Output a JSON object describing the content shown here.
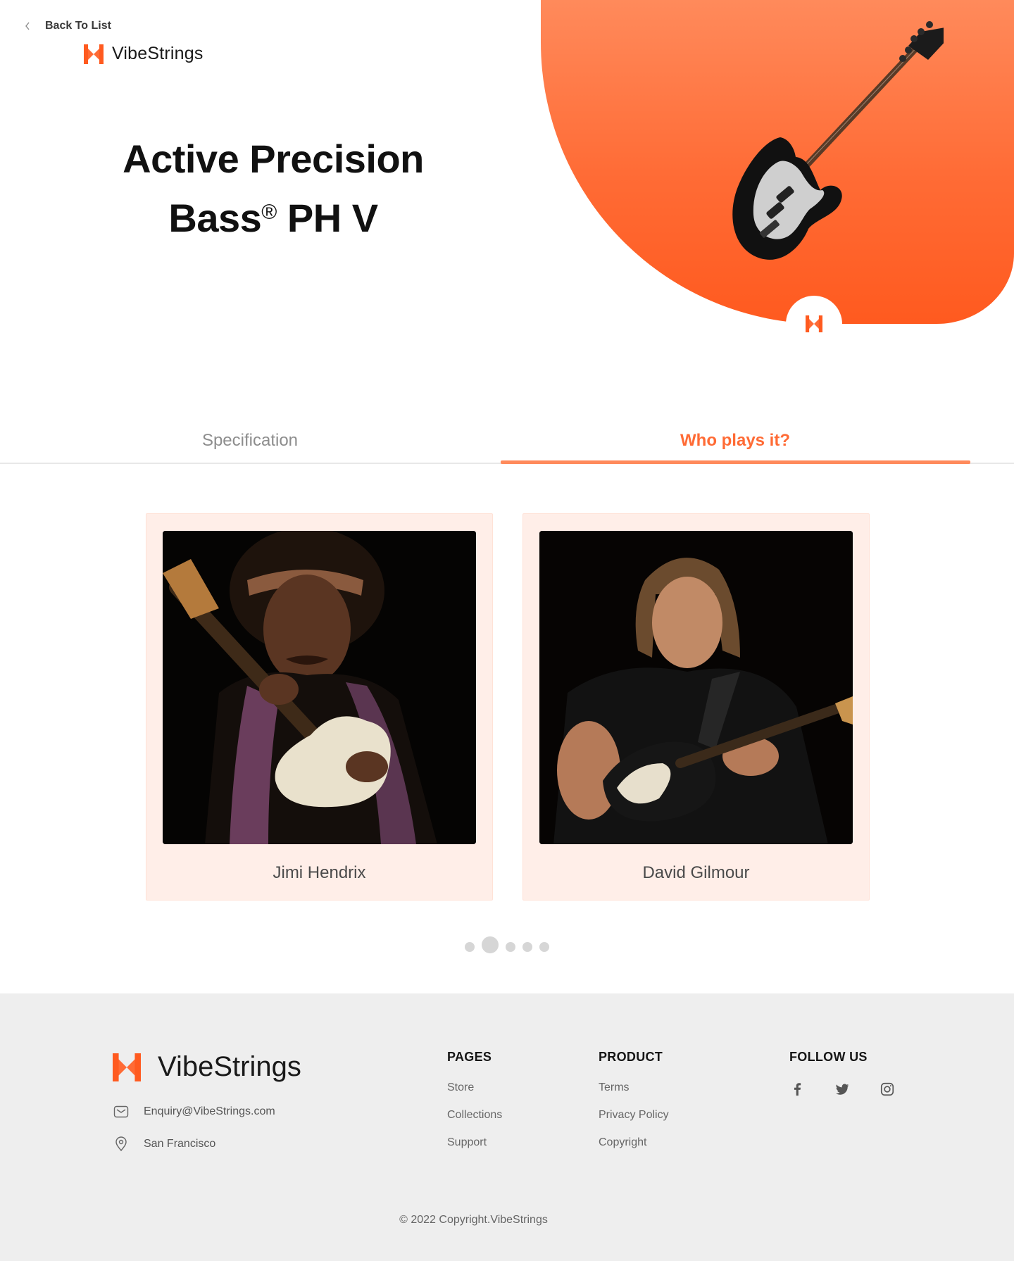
{
  "header": {
    "back_label": "Back To List",
    "brand_name": "VibeStrings"
  },
  "product": {
    "title_line1": "Active Precision",
    "title_line2_a": "Bass",
    "title_line2_sup": "®",
    "title_line2_b": " PH V"
  },
  "colors": {
    "accent": "#ff6b35",
    "accent_light": "#ff8a5b",
    "card_bg": "#ffeee8",
    "footer_bg": "#eeeeee"
  },
  "tabs": [
    {
      "label": "Specification",
      "active": false
    },
    {
      "label": "Who plays it?",
      "active": true
    }
  ],
  "players": [
    {
      "name": "Jimi Hendrix"
    },
    {
      "name": "David Gilmour"
    }
  ],
  "carousel": {
    "total_dots": 5,
    "active_index": 1
  },
  "footer": {
    "brand_name": "VibeStrings",
    "email": "Enquiry@VibeStrings.com",
    "location": "San Francisco",
    "pages_title": "PAGES",
    "pages_links": [
      "Store",
      "Collections",
      "Support"
    ],
    "product_title": "PRODUCT",
    "product_links": [
      "Terms",
      "Privacy Policy",
      "Copyright"
    ],
    "follow_title": "FOLLOW US",
    "social_icons": [
      "facebook-icon",
      "twitter-icon",
      "instagram-icon"
    ],
    "copyright": "© 2022 Copyright.VibeStrings"
  }
}
